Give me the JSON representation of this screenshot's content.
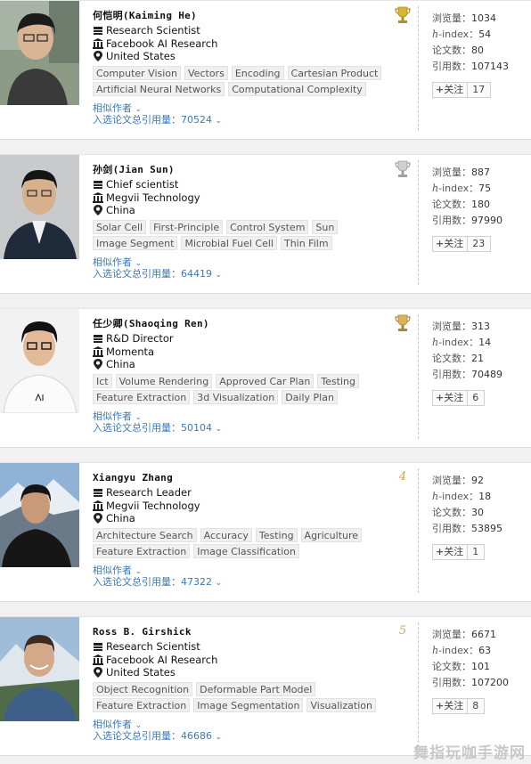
{
  "labels": {
    "views": "浏览量：",
    "h_index_italic": "h",
    "h_index_rest": "-index：",
    "papers": "论文数：",
    "citations": "引用数：",
    "follow": "关注",
    "follow_icon": "+",
    "similar_authors": "相似作者",
    "selected_citations": "入选论文总引用量："
  },
  "colors": {
    "link": "#3b78b8",
    "trophy_gold": "#d8b437",
    "trophy_silver": "#b8b8b8",
    "rank_num": "#c9a655"
  },
  "scholars": [
    {
      "name": "何恺明(Kaiming He)",
      "title": "Research Scientist",
      "org": "Facebook AI Research",
      "country": "United States",
      "rank_icon": "trophy-gold-icon",
      "rank_text": "",
      "tags": [
        [
          "Computer Vision",
          "Vectors",
          "Encoding",
          "Cartesian Product"
        ],
        [
          "Artificial Neural Networks",
          "Computational Complexity"
        ]
      ],
      "selected_citations": "70524",
      "views": "1034",
      "h_index": "54",
      "papers": "80",
      "citations": "107143",
      "follows": "17"
    },
    {
      "name": "孙剑(Jian Sun)",
      "title": "Chief scientist",
      "org": "Megvii Technology",
      "country": "China",
      "rank_icon": "trophy-silver-icon",
      "rank_text": "",
      "tags": [
        [
          "Solar Cell",
          "First-Principle",
          "Control System",
          "Sun"
        ],
        [
          "Image Segment",
          "Microbial Fuel Cell",
          "Thin Film"
        ]
      ],
      "selected_citations": "64419",
      "views": "887",
      "h_index": "75",
      "papers": "180",
      "citations": "97990",
      "follows": "23"
    },
    {
      "name": "任少卿(Shaoqing Ren)",
      "title": "R&D Director",
      "org": "Momenta",
      "country": "China",
      "rank_icon": "trophy-bronze-icon",
      "rank_text": "",
      "tags": [
        [
          "Ict",
          "Volume Rendering",
          "Approved Car Plan",
          "Testing"
        ],
        [
          "Feature Extraction",
          "3d Visualization",
          "Daily Plan"
        ]
      ],
      "selected_citations": "50104",
      "views": "313",
      "h_index": "14",
      "papers": "21",
      "citations": "70489",
      "follows": "6"
    },
    {
      "name": "Xiangyu Zhang",
      "title": "Research Leader",
      "org": "Megvii Technology",
      "country": "China",
      "rank_icon": "",
      "rank_text": "4",
      "tags": [
        [
          "Architecture Search",
          "Accuracy",
          "Testing",
          "Agriculture"
        ],
        [
          "Feature Extraction",
          "Image Classification"
        ]
      ],
      "selected_citations": "47322",
      "views": "92",
      "h_index": "18",
      "papers": "30",
      "citations": "53895",
      "follows": "1"
    },
    {
      "name": "Ross B. Girshick",
      "title": "Research Scientist",
      "org": "Facebook AI Research",
      "country": "United States",
      "rank_icon": "",
      "rank_text": "5",
      "tags": [
        [
          "Object Recognition",
          "Deformable Part Model"
        ],
        [
          "Feature Extraction",
          "Image Segmentation",
          "Visualization"
        ]
      ],
      "selected_citations": "46686",
      "views": "6671",
      "h_index": "63",
      "papers": "101",
      "citations": "107200",
      "follows": "8"
    }
  ],
  "watermark": "舞指玩咖手游网"
}
